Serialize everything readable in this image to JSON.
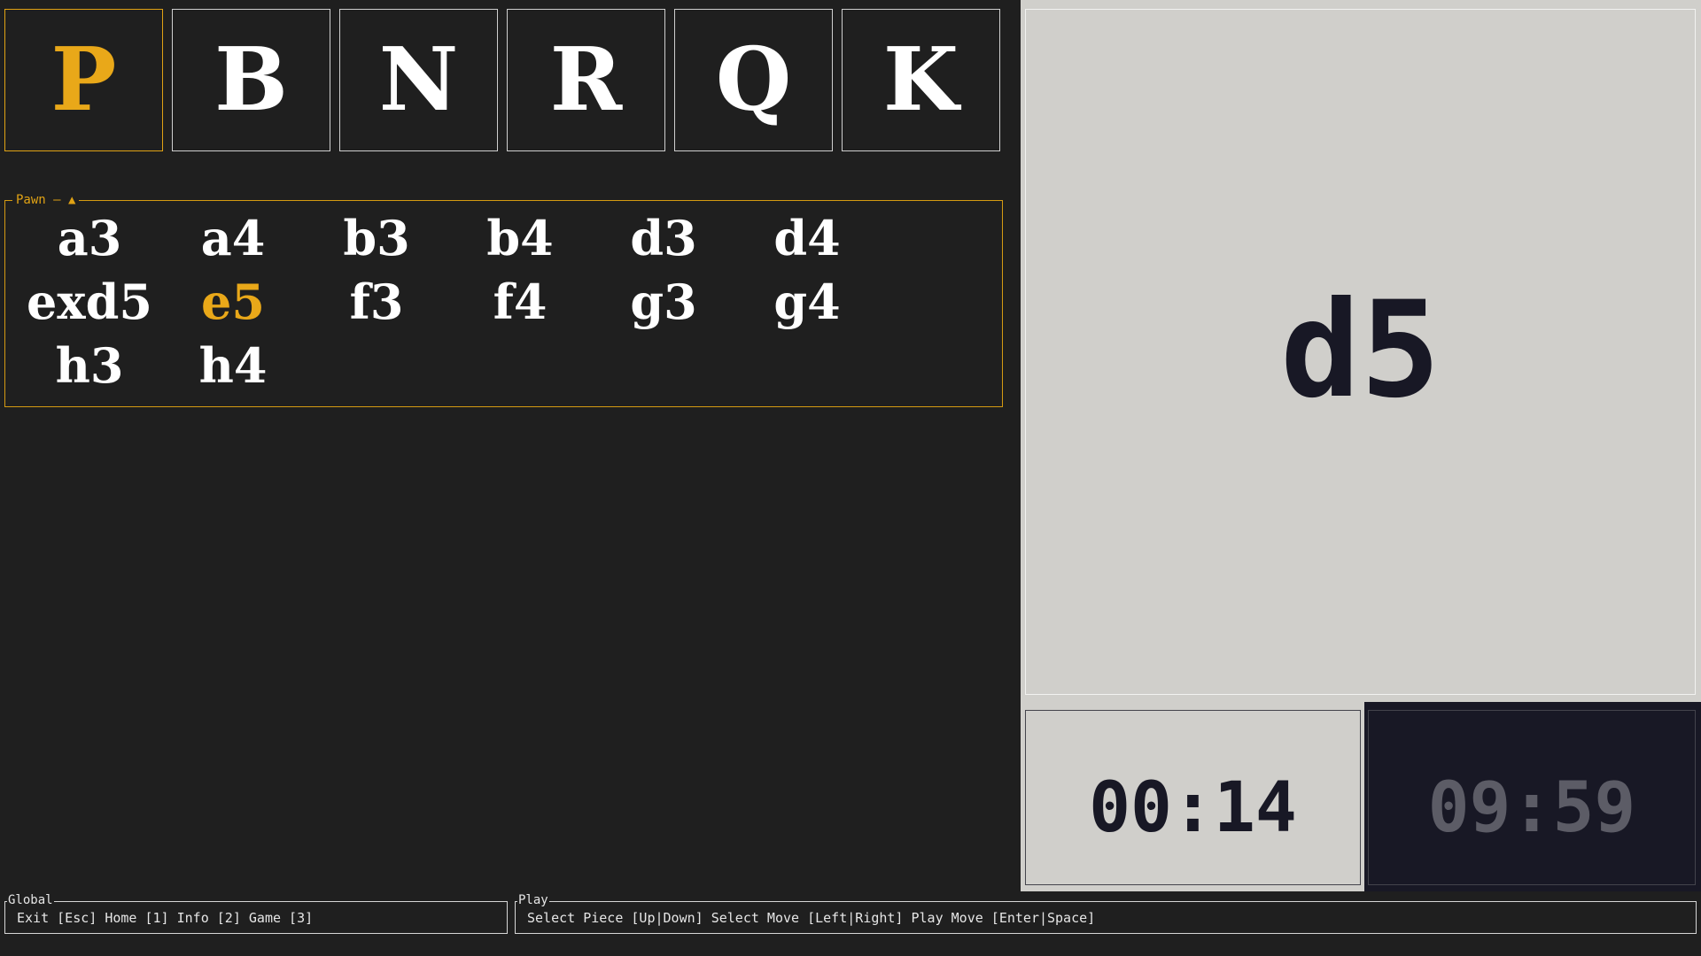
{
  "pieces": [
    {
      "label": "P",
      "selected": true
    },
    {
      "label": "B",
      "selected": false
    },
    {
      "label": "N",
      "selected": false
    },
    {
      "label": "R",
      "selected": false
    },
    {
      "label": "Q",
      "selected": false
    },
    {
      "label": "K",
      "selected": false
    }
  ],
  "moves_panel": {
    "title": "Pawn — ▲",
    "moves": [
      "a3",
      "a4",
      "b3",
      "b4",
      "d3",
      "d4",
      "exd5",
      "e5",
      "f3",
      "f4",
      "g3",
      "g4",
      "h3",
      "h4"
    ],
    "selected_index": 7
  },
  "display": {
    "move": "d5"
  },
  "clocks": {
    "white": "00:14",
    "black": "09:59"
  },
  "footer": {
    "global_title": "Global",
    "global_text": "Exit [Esc] Home [1] Info [2] Game [3]",
    "play_title": "Play",
    "play_text": "Select Piece [Up|Down] Select Move [Left|Right] Play Move [Enter|Space]"
  },
  "colors": {
    "background": "#1f1f1f",
    "accent": "#e9a819",
    "panel_light": "#d0cfcb",
    "panel_dark": "#181825",
    "text": "#ffffff"
  }
}
